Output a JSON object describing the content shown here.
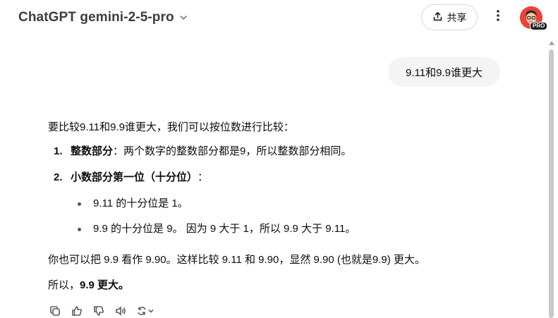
{
  "header": {
    "model_title": "ChatGPT gemini-2-5-pro",
    "share_label": "共享",
    "avatar_badge": "PRO"
  },
  "conversation": {
    "user_message": "9.11和9.9谁更大",
    "assistant": {
      "intro": "要比较9.11和9.9谁更大，我们可以按位数进行比较：",
      "steps": [
        {
          "num": "1.",
          "title": "整数部分",
          "text": "：两个数字的整数部分都是9，所以整数部分相同。"
        },
        {
          "num": "2.",
          "title": "小数部分第一位（十分位）",
          "text": "："
        }
      ],
      "bullets": [
        "9.11 的十分位是 1。",
        "9.9 的十分位是 9。 因为 9 大于 1，所以 9.9 大于 9.11。"
      ],
      "para1": "你也可以把 9.9 看作 9.90。这样比较 9.11 和 9.90，显然 9.90 (也就是9.9) 更大。",
      "conclusion_prefix": "所以，",
      "conclusion_bold": "9.9 更大。"
    }
  },
  "icons": [
    "chevron-down-icon",
    "share-icon",
    "more-vertical-icon",
    "copy-icon",
    "thumbs-up-icon",
    "thumbs-down-icon",
    "speaker-icon",
    "regenerate-icon"
  ]
}
